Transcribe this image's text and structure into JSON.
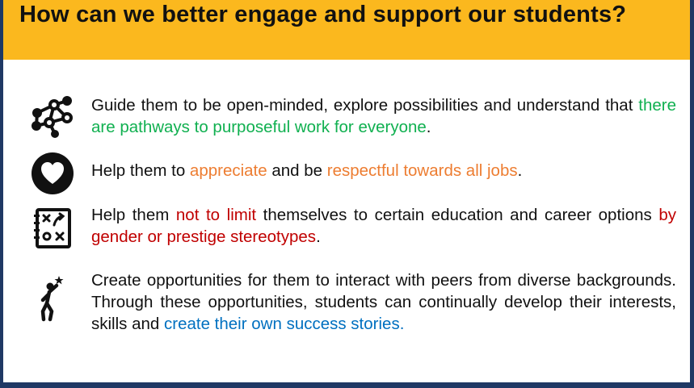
{
  "title": "How can we better engage and support our students?",
  "items": [
    {
      "icon": "network-nodes-icon",
      "segments": [
        {
          "text": "Guide them to be open-minded, explore possibilities and understand that ",
          "color": "#111111"
        },
        {
          "text": "there are pathways to purposeful work for everyone",
          "color": "#10b050"
        },
        {
          "text": ".",
          "color": "#111111"
        }
      ]
    },
    {
      "icon": "heart-circle-icon",
      "segments": [
        {
          "text": "Help them to ",
          "color": "#111111"
        },
        {
          "text": "appreciate",
          "color": "#ed7d31"
        },
        {
          "text": " and be ",
          "color": "#111111"
        },
        {
          "text": "respectful towards all jobs",
          "color": "#ed7d31"
        },
        {
          "text": ".",
          "color": "#111111"
        }
      ]
    },
    {
      "icon": "strategy-board-icon",
      "segments": [
        {
          "text": "Help them ",
          "color": "#111111"
        },
        {
          "text": "not to limit",
          "color": "#c00000"
        },
        {
          "text": " themselves to certain education and career options ",
          "color": "#111111"
        },
        {
          "text": "by gender or prestige stereotypes",
          "color": "#c00000"
        },
        {
          "text": ".",
          "color": "#111111"
        }
      ]
    },
    {
      "icon": "reaching-star-person-icon",
      "segments": [
        {
          "text": "Create opportunities for them to interact with peers from diverse backgrounds. Through these opportunities, students can continually develop their interests, skills and ",
          "color": "#111111"
        },
        {
          "text": "create their own success stories.",
          "color": "#0070c0"
        }
      ]
    }
  ]
}
